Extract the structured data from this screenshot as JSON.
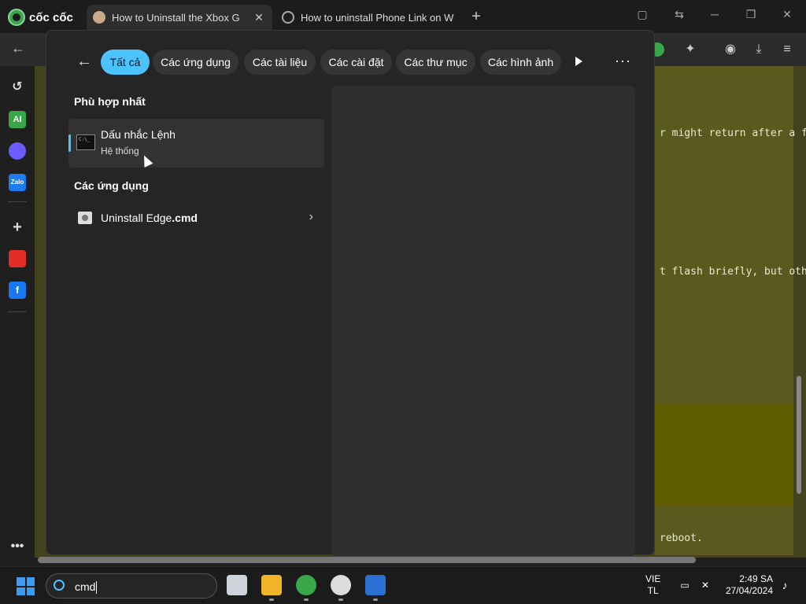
{
  "browser": {
    "brand": "cốc cốc",
    "tabs": [
      {
        "title": "How to Uninstall the Xbox G",
        "active": true
      },
      {
        "title": "How to uninstall Phone Link on W",
        "active": false
      }
    ]
  },
  "page": {
    "lines": [
      "r might return after a featu",
      "t flash briefly, but otherwis",
      "reboot."
    ]
  },
  "search": {
    "filters": [
      "Tất cả",
      "Các ứng dụng",
      "Các tài liệu",
      "Các cài đặt",
      "Các thư mục",
      "Các hình ảnh"
    ],
    "best_match_heading": "Phù hợp nhất",
    "best_match": {
      "title": "Dấu nhắc Lệnh",
      "subtitle": "Hệ thống"
    },
    "apps_heading": "Các ứng dụng",
    "apps": [
      {
        "name_prefix": "Uninstall Edge",
        "name_ext": ".cmd"
      }
    ]
  },
  "taskbar": {
    "search_value": "cmd",
    "lang_line1": "VIE",
    "lang_line2": "TL",
    "time": "2:49 SA",
    "date": "27/04/2024"
  },
  "colors": {
    "accent": "#4cc2ff",
    "page_olive": "#5a5a1e"
  }
}
